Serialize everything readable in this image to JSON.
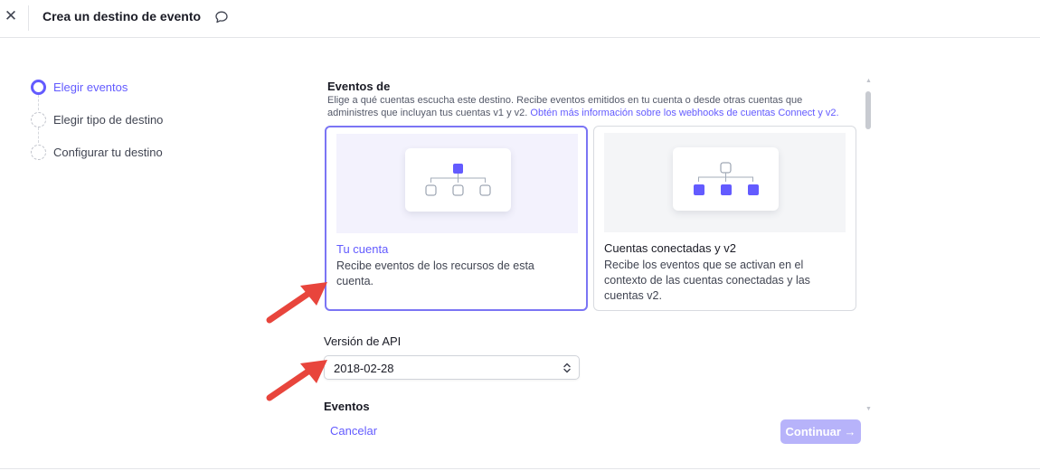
{
  "header": {
    "close_icon": "close-icon",
    "title": "Crea un destino de evento",
    "feedback_icon": "speech-bubble-icon"
  },
  "stepper": {
    "steps": [
      {
        "label": "Elegir eventos",
        "state": "active"
      },
      {
        "label": "Elegir tipo de destino",
        "state": "pending"
      },
      {
        "label": "Configurar tu destino",
        "state": "pending"
      }
    ]
  },
  "events_from": {
    "title": "Eventos de",
    "description": "Elige a qué cuentas escucha este destino. Recibe eventos emitidos en tu cuenta o desde otras cuentas que administres que incluyan tus cuentas v1 y v2.",
    "link": "Obtén más información sobre los webhooks de cuentas Connect y v2."
  },
  "cards": [
    {
      "title": "Tu cuenta",
      "description": "Recibe eventos de los recursos de esta cuenta.",
      "selected": true
    },
    {
      "title": "Cuentas conectadas y v2",
      "description": "Recibe los eventos que se activan en el contexto de las cuentas conectadas y las cuentas v2.",
      "selected": false
    }
  ],
  "api_version": {
    "label": "Versión de API",
    "value": "2018-02-28"
  },
  "events": {
    "label": "Eventos"
  },
  "footer": {
    "cancel_label": "Cancelar",
    "continue_label": "Continuar →"
  },
  "colors": {
    "accent": "#635bff",
    "continue_disabled_bg": "#b7b3fa",
    "annotation_arrow": "#e8453c"
  }
}
